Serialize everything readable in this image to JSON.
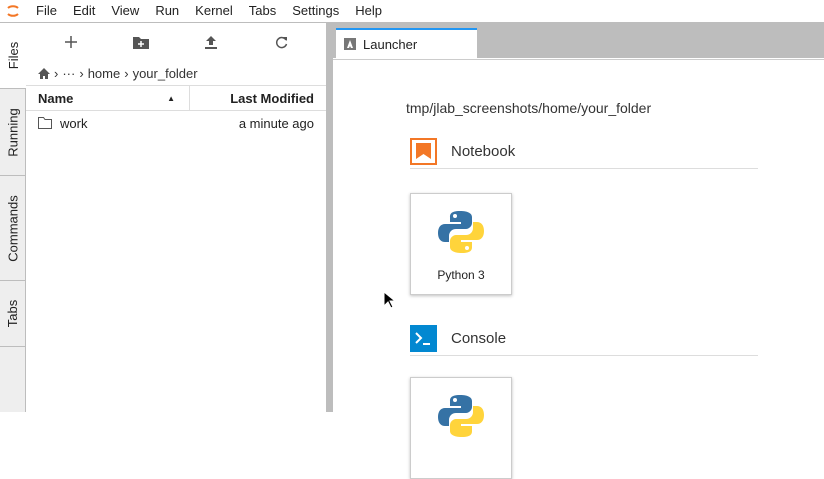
{
  "menu": [
    "File",
    "Edit",
    "View",
    "Run",
    "Kernel",
    "Tabs",
    "Settings",
    "Help"
  ],
  "left_tabs": [
    "Files",
    "Running",
    "Commands",
    "Tabs"
  ],
  "breadcrumb": {
    "ellipsis": "···",
    "items": [
      "home",
      "your_folder"
    ]
  },
  "file_list": {
    "headers": {
      "name": "Name",
      "modified": "Last Modified"
    },
    "rows": [
      {
        "name": "work",
        "modified": "a minute ago",
        "type": "folder"
      }
    ]
  },
  "main": {
    "tab_label": "Launcher",
    "cwd": "tmp/jlab_screenshots/home/your_folder",
    "sections": [
      {
        "title": "Notebook",
        "cards": [
          "Python 3"
        ]
      },
      {
        "title": "Console",
        "cards": [
          ""
        ]
      }
    ]
  },
  "colors": {
    "accent": "#2196f3",
    "notebook": "#f37726",
    "console": "#0288d1"
  }
}
